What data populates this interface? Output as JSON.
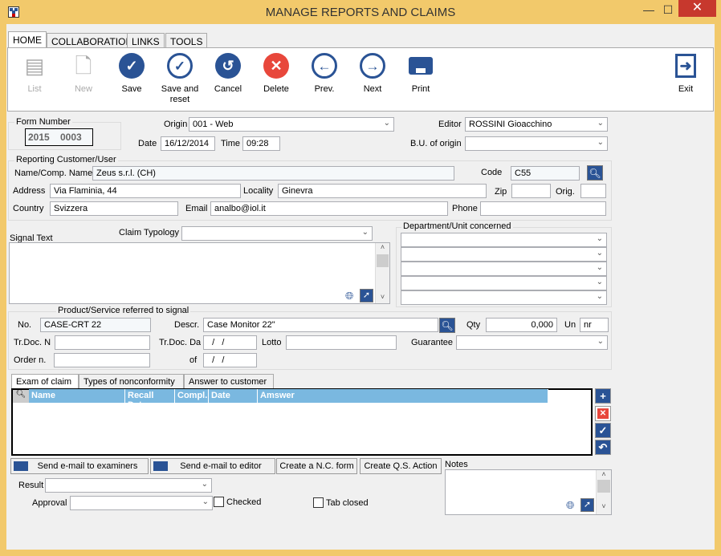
{
  "window": {
    "title": "MANAGE REPORTS AND CLAIMS",
    "minimize": "—",
    "maximize": "☐",
    "close": "✕"
  },
  "tabs": [
    "HOME",
    "COLLABORATION",
    "LINKS",
    "TOOLS"
  ],
  "toolbar": {
    "list": "List",
    "new": "New",
    "save": "Save",
    "save_reset_1": "Save and",
    "save_reset_2": "reset",
    "cancel": "Cancel",
    "delete": "Delete",
    "prev": "Prev.",
    "next": "Next",
    "print": "Print",
    "exit": "Exit"
  },
  "header": {
    "form_number_label": "Form Number",
    "year": "2015",
    "number": "0003",
    "origin_label": "Origin",
    "origin": "001 - Web",
    "date_label": "Date",
    "date": "16/12/2014",
    "time_label": "Time",
    "time": "09:28",
    "editor_label": "Editor",
    "editor": "ROSSINI Gioacchino",
    "bu_label": "B.U. of origin",
    "bu": ""
  },
  "customer": {
    "group": "Reporting Customer/User",
    "name_label": "Name/Comp. Name",
    "name": "Zeus s.r.l. (CH)",
    "code_label": "Code",
    "code": "C55",
    "address_label": "Address",
    "address": "Via Flaminia, 44",
    "locality_label": "Locality",
    "locality": "Ginevra",
    "zip_label": "Zip",
    "zip": "",
    "orig_label": "Orig.",
    "orig": "",
    "country_label": "Country",
    "country": "Svizzera",
    "email_label": "Email",
    "email": "analbo@iol.it",
    "phone_label": "Phone",
    "phone": ""
  },
  "signal": {
    "label": "Signal Text",
    "typology_label": "Claim Typology",
    "typology": "",
    "text": ""
  },
  "department": {
    "group": "Department/Unit concerned",
    "values": [
      "",
      "",
      "",
      "",
      ""
    ]
  },
  "product": {
    "group": "Product/Service referred to signal",
    "no_label": "No.",
    "no": "CASE-CRT 22",
    "descr_label": "Descr.",
    "descr": "Case Monitor 22\"",
    "qty_label": "Qty",
    "qty": "0,000",
    "un_label": "Un",
    "un": "nr",
    "trdocn_label": "Tr.Doc. N",
    "trdocn": "",
    "trdocda_label": "Tr.Doc. Da",
    "trdocda": "  /   /",
    "lotto_label": "Lotto",
    "lotto": "",
    "guarantee_label": "Guarantee",
    "guarantee": "",
    "order_label": "Order n.",
    "order": "",
    "of_label": "of",
    "of": "  /   /"
  },
  "subtabs": [
    "Exam of claim",
    "Types of nonconformity",
    "Answer to customer"
  ],
  "grid": {
    "columns": [
      "Name",
      "Recall Date",
      "Compl.",
      "Date",
      "Amswer"
    ],
    "rows": []
  },
  "actions": {
    "email_examiners": "Send e-mail to examiners",
    "email_editor": "Send e-mail to editor",
    "nc_form": "Create a N.C. form",
    "qs_action": "Create Q.S. Action"
  },
  "bottom": {
    "result_label": "Result",
    "result": "",
    "approval_label": "Approval",
    "approval": "",
    "checked_label": "Checked",
    "checked": false,
    "tab_closed_label": "Tab closed",
    "tab_closed": false,
    "notes_label": "Notes",
    "notes": ""
  },
  "colors": {
    "accent": "#2a5395",
    "frame": "#f2c96b",
    "grid_header": "#7ab8e0",
    "delete": "#e8473b"
  }
}
